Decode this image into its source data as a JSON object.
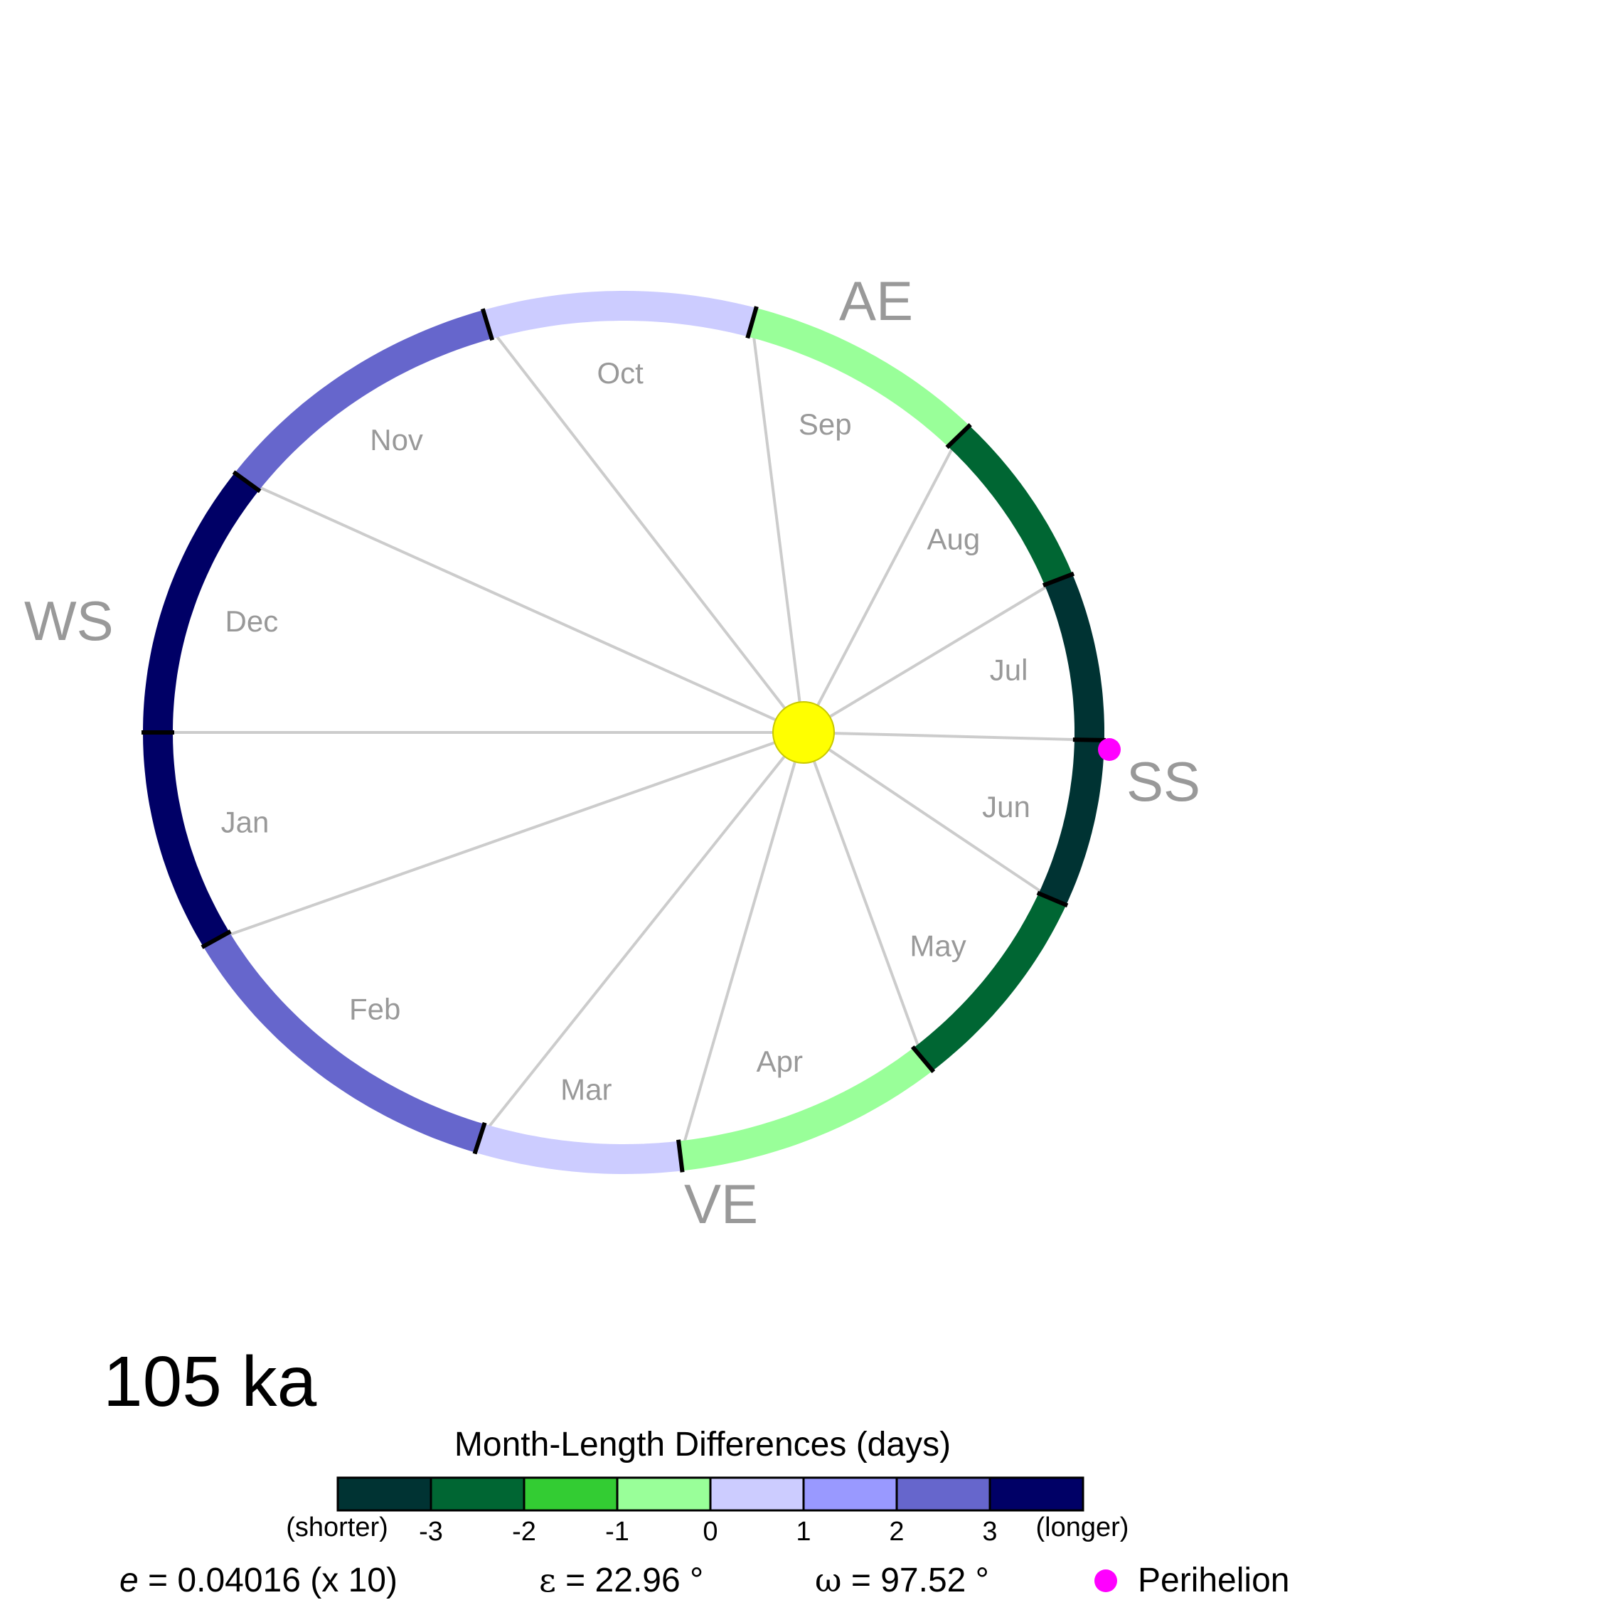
{
  "title": "105 ka",
  "colors": {
    "ray": "#cccccc",
    "sun_fill": "#ffff00",
    "sun_stroke": "#c8c800",
    "tick": "#000000",
    "perihelion": "#ff00ff",
    "label_gray": "#999999"
  },
  "chart_data": {
    "type": "orbit-diagram",
    "months": [
      {
        "name": "Jan",
        "days_diff": 3,
        "color": "#000066"
      },
      {
        "name": "Feb",
        "days_diff": 2,
        "color": "#6666cc"
      },
      {
        "name": "Mar",
        "days_diff": 0.5,
        "color": "#ccccff"
      },
      {
        "name": "Apr",
        "days_diff": -0.5,
        "color": "#99ff99"
      },
      {
        "name": "May",
        "days_diff": -2.5,
        "color": "#006633"
      },
      {
        "name": "Jun",
        "days_diff": -3.5,
        "color": "#003333"
      },
      {
        "name": "Jul",
        "days_diff": -3.5,
        "color": "#003333"
      },
      {
        "name": "Aug",
        "days_diff": -2.5,
        "color": "#006633"
      },
      {
        "name": "Sep",
        "days_diff": -0.5,
        "color": "#99ff99"
      },
      {
        "name": "Oct",
        "days_diff": 0.5,
        "color": "#ccccff"
      },
      {
        "name": "Nov",
        "days_diff": 2,
        "color": "#6666cc"
      },
      {
        "name": "Dec",
        "days_diff": 3,
        "color": "#000066"
      }
    ],
    "seasons": {
      "AE": "AE",
      "WS": "WS",
      "SS": "SS",
      "VE": "VE"
    },
    "legend": {
      "title": "Month-Length Differences (days)",
      "left_label": "(shorter)",
      "right_label": "(longer)",
      "ticks": [
        "-3",
        "-2",
        "-1",
        "0",
        "1",
        "2",
        "3"
      ],
      "colors": [
        "#003333",
        "#006633",
        "#33cc33",
        "#99ff99",
        "#ccccff",
        "#9999ff",
        "#6666cc",
        "#000066"
      ]
    },
    "parameters": {
      "e_symbol": "e",
      "e_value": " = 0.04016 (x 10)",
      "obliquity_symbol": "ε",
      "obliquity_value": " = 22.96 °",
      "omega_symbol": "ω",
      "omega_value": " = 97.52 °"
    },
    "perihelion_label": "Perihelion"
  }
}
